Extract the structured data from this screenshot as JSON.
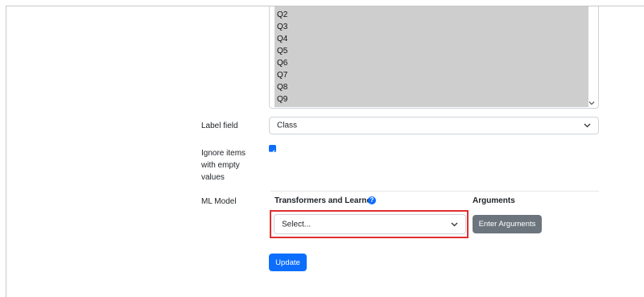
{
  "list": {
    "options": [
      "Q2",
      "Q3",
      "Q4",
      "Q5",
      "Q6",
      "Q7",
      "Q8",
      "Q9"
    ],
    "scroll_icon": "chevron-down-icon"
  },
  "form": {
    "label_field": {
      "label": "Label field",
      "selected": "Class"
    },
    "ignore_empty": {
      "label_line1": "Ignore items",
      "label_line2": "with empty",
      "label_line3": "values",
      "checked": true
    },
    "ml_model": {
      "label": "ML Model",
      "transformers_header": "Transformers and Learner",
      "help_icon": "?",
      "arguments_header": "Arguments",
      "select_placeholder": "Select...",
      "enter_arguments_label": "Enter Arguments"
    },
    "update_label": "Update"
  },
  "colors": {
    "primary": "#0d6efd",
    "secondary": "#6c757d",
    "highlight": "#e03030",
    "selected_bg": "#cecece"
  }
}
